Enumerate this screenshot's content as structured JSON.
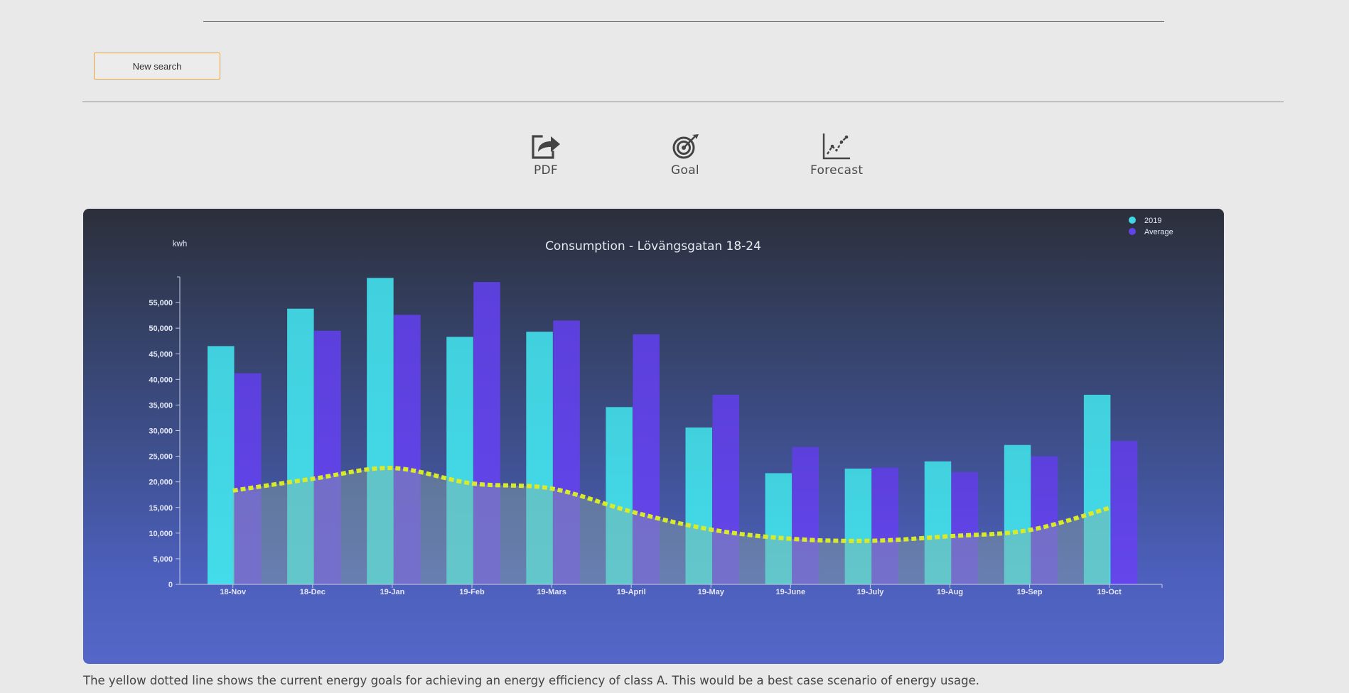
{
  "toolbar": {
    "new_search_label": "New search",
    "tools": [
      {
        "label": "PDF",
        "icon": "pdf-export-icon"
      },
      {
        "label": "Goal",
        "icon": "target-goal-icon"
      },
      {
        "label": "Forecast",
        "icon": "forecast-chart-icon"
      }
    ]
  },
  "chart_data": {
    "type": "bar",
    "title": "Consumption - Lövängsgatan 18-24",
    "ylabel": "kwh",
    "xlabel": "",
    "ylim": [
      0,
      60000
    ],
    "yticks": [
      0,
      5000,
      10000,
      15000,
      20000,
      25000,
      30000,
      35000,
      40000,
      45000,
      50000,
      55000
    ],
    "ytick_labels": [
      "0",
      "5,000",
      "10,000",
      "15,000",
      "20,000",
      "25,000",
      "30,000",
      "35,000",
      "40,000",
      "45,000",
      "50,000",
      "55,000"
    ],
    "categories": [
      "18-Nov",
      "18-Dec",
      "19-Jan",
      "19-Feb",
      "19-Mars",
      "19-April",
      "19-May",
      "19-June",
      "19-July",
      "19-Aug",
      "19-Sep",
      "19-Oct"
    ],
    "series": [
      {
        "name": "2019",
        "values": [
          46500,
          53800,
          59800,
          48300,
          49300,
          34600,
          30600,
          21700,
          22600,
          24000,
          27200,
          37000
        ],
        "color": "#41d8e6"
      },
      {
        "name": "Average",
        "values": [
          41200,
          49500,
          52600,
          59000,
          51500,
          48800,
          37000,
          26800,
          22800,
          21900,
          25000,
          28000
        ],
        "color": "#6044e6"
      },
      {
        "name": "",
        "type": "line",
        "style": "dotted",
        "values": [
          18300,
          20600,
          22700,
          19700,
          18700,
          14200,
          10700,
          8900,
          8500,
          9400,
          10600,
          14900
        ],
        "color": "#d8ea2a"
      }
    ],
    "legend": {
      "position": "top-right"
    },
    "grid": false
  },
  "footnote": "The yellow dotted line shows the current energy goals for achieving an energy efficiency of class A. This would be a best case scenario of energy usage."
}
